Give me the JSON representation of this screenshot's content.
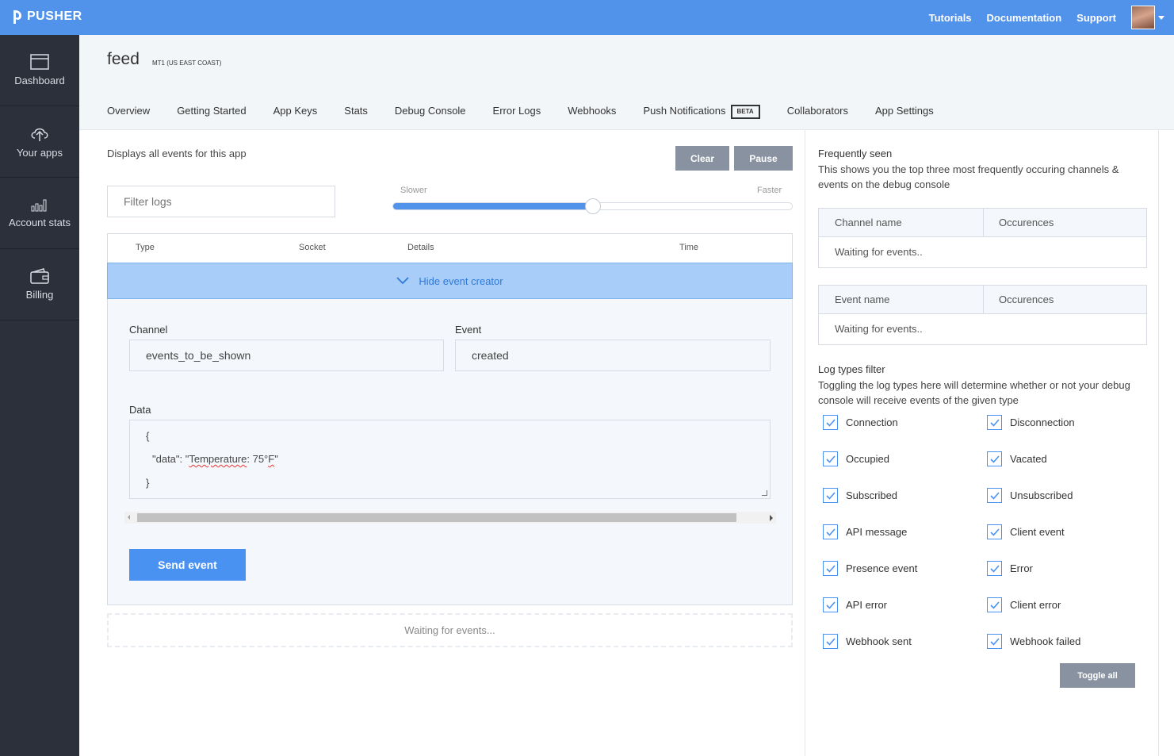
{
  "brand": {
    "name": "PUSHER"
  },
  "topnav": {
    "tutorials": "Tutorials",
    "documentation": "Documentation",
    "support": "Support"
  },
  "sidebar": {
    "items": [
      {
        "label": "Dashboard",
        "icon": "dashboard-icon"
      },
      {
        "label": "Your apps",
        "icon": "upload-cloud-icon"
      },
      {
        "label": "Account stats",
        "icon": "bar-chart-icon"
      },
      {
        "label": "Billing",
        "icon": "wallet-icon"
      }
    ]
  },
  "app": {
    "title": "feed",
    "cluster": "MT1 (US EAST COAST)"
  },
  "tabs": [
    {
      "label": "Overview"
    },
    {
      "label": "Getting Started"
    },
    {
      "label": "App Keys"
    },
    {
      "label": "Stats"
    },
    {
      "label": "Debug Console",
      "active": true
    },
    {
      "label": "Error Logs"
    },
    {
      "label": "Webhooks"
    },
    {
      "label": "Push Notifications",
      "badge": "BETA"
    },
    {
      "label": "Collaborators"
    },
    {
      "label": "App Settings"
    }
  ],
  "console": {
    "description": "Displays all events for this app",
    "clear_label": "Clear",
    "pause_label": "Pause",
    "filter_placeholder": "Filter logs",
    "speed": {
      "slower": "Slower",
      "faster": "Faster",
      "value_fraction": 0.5
    },
    "columns": {
      "type": "Type",
      "socket": "Socket",
      "details": "Details",
      "time": "Time"
    },
    "hide_creator_label": "Hide event creator",
    "creator": {
      "channel_label": "Channel",
      "channel_value": "events_to_be_shown",
      "event_label": "Event",
      "event_value": "created",
      "data_label": "Data",
      "data_line1": "{",
      "data_line2_key": "\"data\": \"",
      "data_line2_word": "Temperature",
      "data_line2_rest": ": 75°",
      "data_line2_unit": "F",
      "data_line2_end": "\"",
      "data_line3": "}",
      "send_label": "Send event"
    },
    "waiting_text": "Waiting for events..."
  },
  "frequently_seen": {
    "title": "Frequently seen",
    "description": "This shows you the top three most frequently occuring channels & events on the debug console",
    "channel_table": {
      "col1": "Channel name",
      "col2": "Occurences",
      "body": "Waiting for events.."
    },
    "event_table": {
      "col1": "Event name",
      "col2": "Occurences",
      "body": "Waiting for events.."
    }
  },
  "log_filter": {
    "title": "Log types filter",
    "description": "Toggling the log types here will determine whether or not your debug console will receive events of the given type",
    "items": [
      {
        "label": "Connection",
        "checked": true
      },
      {
        "label": "Disconnection",
        "checked": true
      },
      {
        "label": "Occupied",
        "checked": true
      },
      {
        "label": "Vacated",
        "checked": true
      },
      {
        "label": "Subscribed",
        "checked": true
      },
      {
        "label": "Unsubscribed",
        "checked": true
      },
      {
        "label": "API message",
        "checked": true
      },
      {
        "label": "Client event",
        "checked": true
      },
      {
        "label": "Presence event",
        "checked": true
      },
      {
        "label": "Error",
        "checked": true
      },
      {
        "label": "API error",
        "checked": true
      },
      {
        "label": "Client error",
        "checked": true
      },
      {
        "label": "Webhook sent",
        "checked": true
      },
      {
        "label": "Webhook failed",
        "checked": true
      }
    ],
    "toggle_all_label": "Toggle all"
  },
  "colors": {
    "brand_blue": "#5192ea",
    "sidebar": "#2b303b",
    "gray_button": "#8992a1"
  }
}
